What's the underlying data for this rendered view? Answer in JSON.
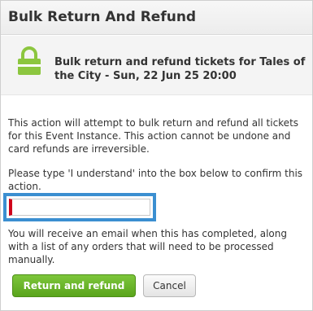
{
  "dialog": {
    "title": "Bulk Return And Refund"
  },
  "banner": {
    "icon": "lock-icon",
    "icon_color": "#8cc63f",
    "heading": "Bulk return and refund tickets for Tales of the City - Sun, 22 Jun 25 20:00"
  },
  "body": {
    "warning": "This action will attempt to bulk return and refund all tickets for this Event Instance. This action cannot be undone and card refunds are irreversible.",
    "instruction": "Please type 'I understand' into the box below to confirm this action.",
    "info": "You will receive an email when this has completed, along with a list of any orders that will need to be processed manually."
  },
  "confirm_input": {
    "value": "",
    "placeholder": "",
    "focus_color": "#3b8fd1",
    "error_color": "#d0021b"
  },
  "actions": {
    "confirm_label": "Return and refund",
    "confirm_color": "#6ab42a",
    "cancel_label": "Cancel"
  }
}
